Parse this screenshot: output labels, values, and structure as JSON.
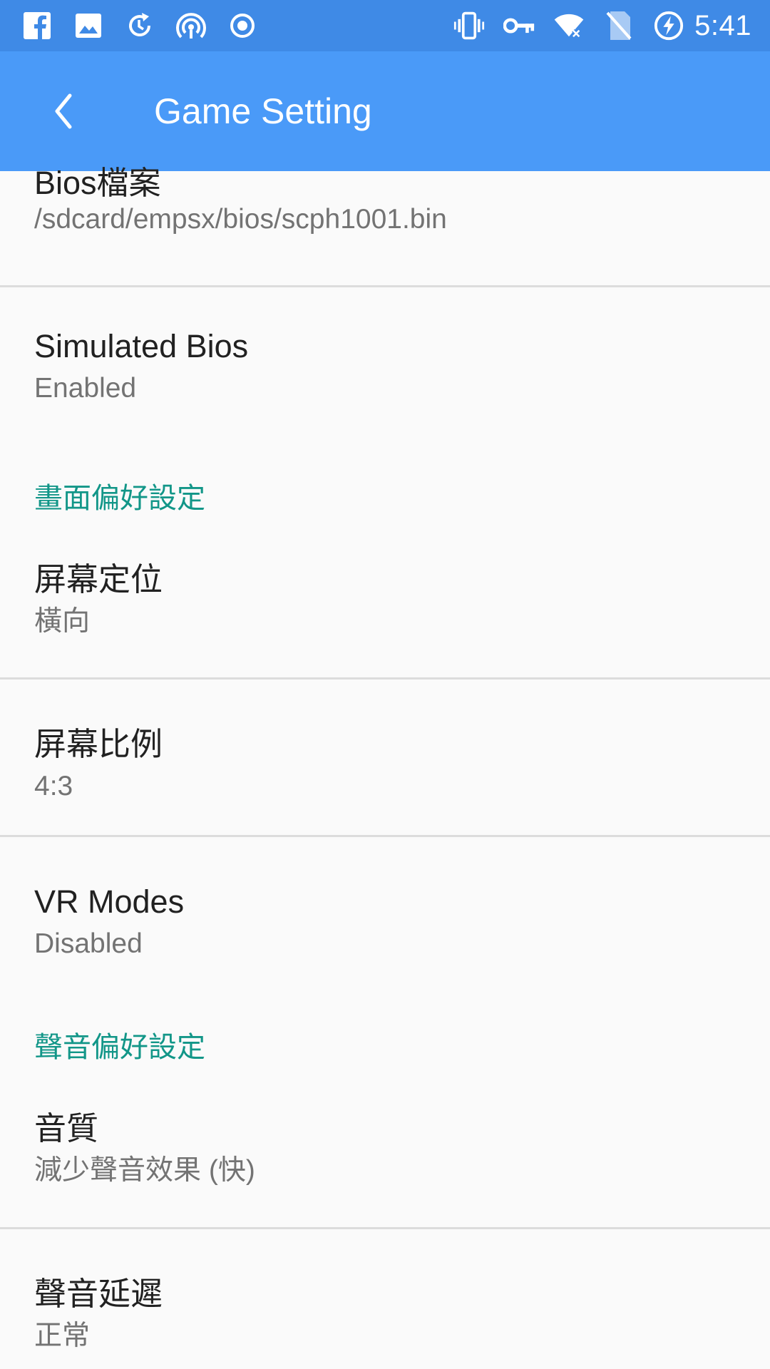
{
  "status_bar": {
    "left_icons": [
      "facebook-icon",
      "image-icon",
      "sync-clock-icon",
      "hotspot-icon",
      "record-icon"
    ],
    "right_icons": [
      "vibrate-icon",
      "vpn-key-icon",
      "wifi-off-icon",
      "no-sim-icon",
      "battery-charging-icon"
    ],
    "time": "5:41"
  },
  "toolbar": {
    "title": "Game Setting",
    "back_icon": "chevron-left-icon"
  },
  "preferences": {
    "bios_file": {
      "title": "Bios檔案",
      "summary": "/sdcard/empsx/bios/scph1001.bin"
    },
    "simulated_bios": {
      "title": "Simulated Bios",
      "summary": "Enabled"
    },
    "display_category": "畫面偏好設定",
    "screen_orientation": {
      "title": "屏幕定位",
      "summary": "橫向"
    },
    "screen_ratio": {
      "title": "屏幕比例",
      "summary": "4:3"
    },
    "vr_modes": {
      "title": "VR Modes",
      "summary": "Disabled"
    },
    "sound_category": "聲音偏好設定",
    "sound_quality": {
      "title": "音質",
      "summary": "減少聲音效果 (快)"
    },
    "sound_latency": {
      "title": "聲音延遲",
      "summary": "正常"
    }
  },
  "colors": {
    "status_bar": "#3f8ae6",
    "toolbar": "#4a9af8",
    "category_accent": "#129688",
    "background": "#fafafa"
  }
}
